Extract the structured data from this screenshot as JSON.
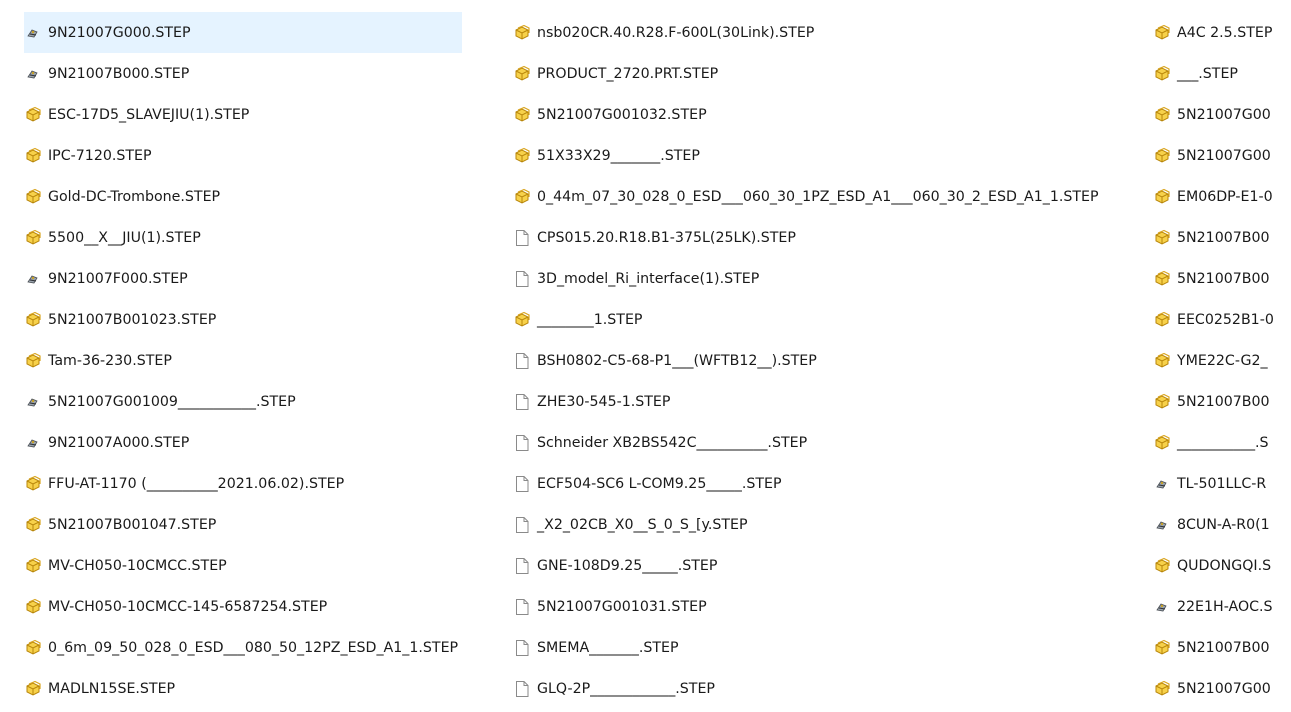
{
  "columns": [
    {
      "items": [
        {
          "name": "9N21007G000.STEP",
          "icon": "thumbnail-part-icon",
          "selected": true
        },
        {
          "name": "9N21007B000.STEP",
          "icon": "thumbnail-part-icon"
        },
        {
          "name": "ESC-17D5_SLAVEJIU(1).STEP",
          "icon": "cad-step-icon"
        },
        {
          "name": "IPC-7120.STEP",
          "icon": "cad-step-icon"
        },
        {
          "name": "Gold-DC-Trombone.STEP",
          "icon": "cad-step-icon"
        },
        {
          "name": "5500__X__JIU(1).STEP",
          "icon": "cad-step-icon"
        },
        {
          "name": "9N21007F000.STEP",
          "icon": "thumbnail-part-icon"
        },
        {
          "name": "5N21007B001023.STEP",
          "icon": "cad-step-icon"
        },
        {
          "name": "Tam-36-230.STEP",
          "icon": "cad-step-icon"
        },
        {
          "name": "5N21007G001009___________.STEP",
          "icon": "thumbnail-part-icon"
        },
        {
          "name": "9N21007A000.STEP",
          "icon": "thumbnail-part-icon"
        },
        {
          "name": "FFU-AT-1170 (__________2021.06.02).STEP",
          "icon": "cad-step-icon"
        },
        {
          "name": "5N21007B001047.STEP",
          "icon": "cad-step-icon"
        },
        {
          "name": "MV-CH050-10CMCC.STEP",
          "icon": "cad-step-icon"
        },
        {
          "name": "MV-CH050-10CMCC-145-6587254.STEP",
          "icon": "cad-step-icon"
        },
        {
          "name": "0_6m_09_50_028_0_ESD___080_50_12PZ_ESD_A1_1.STEP",
          "icon": "cad-step-icon"
        },
        {
          "name": "MADLN15SE.STEP",
          "icon": "cad-step-icon"
        }
      ]
    },
    {
      "items": [
        {
          "name": "nsb020CR.40.R28.F-600L(30Link).STEP",
          "icon": "cad-step-icon"
        },
        {
          "name": "PRODUCT_2720.PRT.STEP",
          "icon": "cad-step-icon"
        },
        {
          "name": "5N21007G001032.STEP",
          "icon": "cad-step-icon"
        },
        {
          "name": "51X33X29_______.STEP",
          "icon": "cad-step-icon"
        },
        {
          "name": "0_44m_07_30_028_0_ESD___060_30_1PZ_ESD_A1___060_30_2_ESD_A1_1.STEP",
          "icon": "cad-step-icon"
        },
        {
          "name": "CPS015.20.R18.B1-375L(25LK).STEP",
          "icon": "blank-file-icon"
        },
        {
          "name": "3D_model_Ri_interface(1).STEP",
          "icon": "blank-file-icon"
        },
        {
          "name": "________1.STEP",
          "icon": "cad-step-icon"
        },
        {
          "name": "BSH0802-C5-68-P1___(WFTB12__).STEP",
          "icon": "blank-file-icon"
        },
        {
          "name": "ZHE30-545-1.STEP",
          "icon": "blank-file-icon"
        },
        {
          "name": "Schneider  XB2BS542C__________.STEP",
          "icon": "blank-file-icon"
        },
        {
          "name": "ECF504-SC6 L-COM9.25_____.STEP",
          "icon": "blank-file-icon"
        },
        {
          "name": "_X2_02CB_X0__S_0_S_[y.STEP",
          "icon": "blank-file-icon"
        },
        {
          "name": "GNE-108D9.25_____.STEP",
          "icon": "blank-file-icon"
        },
        {
          "name": "5N21007G001031.STEP",
          "icon": "blank-file-icon"
        },
        {
          "name": "SMEMA_______.STEP",
          "icon": "blank-file-icon"
        },
        {
          "name": "GLQ-2P____________.STEP",
          "icon": "blank-file-icon"
        }
      ]
    },
    {
      "items": [
        {
          "name": "A4C 2.5.STEP",
          "icon": "cad-step-icon"
        },
        {
          "name": "___.STEP",
          "icon": "cad-step-icon"
        },
        {
          "name": "5N21007G00",
          "icon": "cad-step-icon"
        },
        {
          "name": "5N21007G00",
          "icon": "cad-step-icon"
        },
        {
          "name": "EM06DP-E1-0",
          "icon": "cad-step-icon"
        },
        {
          "name": "5N21007B00",
          "icon": "cad-step-icon"
        },
        {
          "name": "5N21007B00",
          "icon": "cad-step-icon"
        },
        {
          "name": "EEC0252B1-0",
          "icon": "cad-step-icon"
        },
        {
          "name": "YME22C-G2_",
          "icon": "cad-step-icon"
        },
        {
          "name": "5N21007B00",
          "icon": "cad-step-icon"
        },
        {
          "name": "___________.S",
          "icon": "cad-step-icon"
        },
        {
          "name": "TL-501LLC-R",
          "icon": "thumbnail-part-icon"
        },
        {
          "name": "8CUN-A-R0(1",
          "icon": "thumbnail-part-icon"
        },
        {
          "name": "QUDONGQI.S",
          "icon": "cad-step-icon"
        },
        {
          "name": "22E1H-AOC.S",
          "icon": "thumbnail-part-icon"
        },
        {
          "name": "5N21007B00",
          "icon": "cad-step-icon"
        },
        {
          "name": "5N21007G00",
          "icon": "cad-step-icon"
        }
      ]
    }
  ],
  "colors": {
    "selection": "#e5f3ff",
    "step_icon_fill": "#f7d14a",
    "step_icon_stroke": "#b8860b",
    "text": "#1a1a1a"
  }
}
